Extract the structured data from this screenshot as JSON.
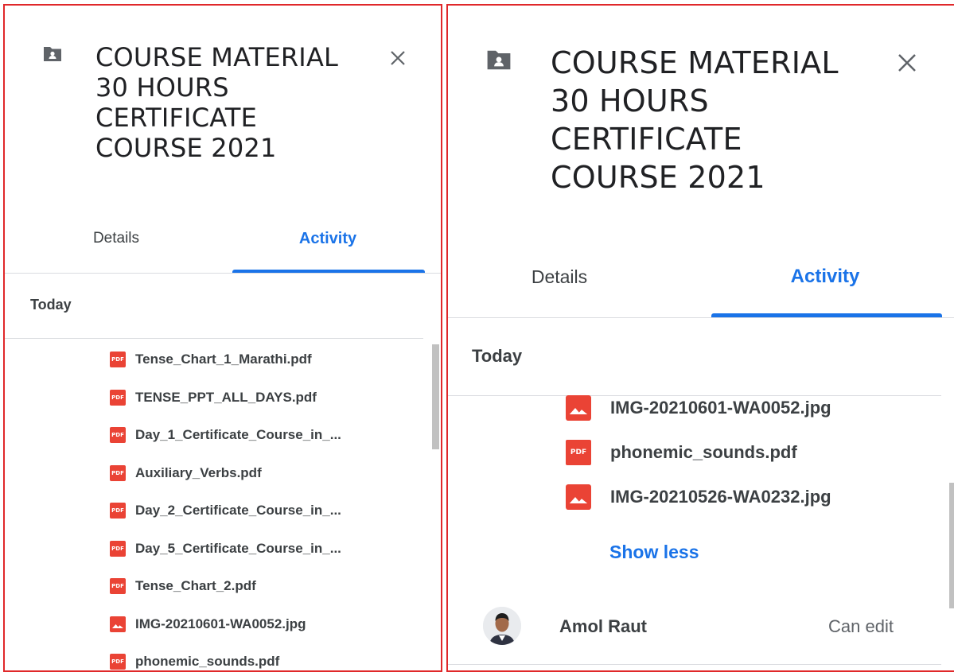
{
  "left_panel": {
    "folder_icon": "shared-folder-icon",
    "close_icon": "close-icon",
    "title_lines": [
      "COURSE MATERIAL",
      "30 HOURS",
      "CERTIFICATE",
      "COURSE 2021"
    ],
    "tabs": [
      {
        "label": "Details",
        "active": false
      },
      {
        "label": "Activity",
        "active": true
      }
    ],
    "section_label": "Today",
    "files": [
      {
        "type": "pdf",
        "icon_text": "PDF",
        "name": "Tense_Chart_1_Marathi.pdf"
      },
      {
        "type": "pdf",
        "icon_text": "PDF",
        "name": "TENSE_PPT_ALL_DAYS.pdf"
      },
      {
        "type": "pdf",
        "icon_text": "PDF",
        "name": "Day_1_Certificate_Course_in_..."
      },
      {
        "type": "pdf",
        "icon_text": "PDF",
        "name": "Auxiliary_Verbs.pdf"
      },
      {
        "type": "pdf",
        "icon_text": "PDF",
        "name": "Day_2_Certificate_Course_in_..."
      },
      {
        "type": "pdf",
        "icon_text": "PDF",
        "name": "Day_5_Certificate_Course_in_..."
      },
      {
        "type": "pdf",
        "icon_text": "PDF",
        "name": "Tense_Chart_2.pdf"
      },
      {
        "type": "image",
        "icon_text": "",
        "name": "IMG-20210601-WA0052.jpg"
      },
      {
        "type": "pdf",
        "icon_text": "PDF",
        "name": "phonemic_sounds.pdf"
      }
    ]
  },
  "right_panel": {
    "folder_icon": "shared-folder-icon",
    "close_icon": "close-icon",
    "title_lines": [
      "COURSE MATERIAL",
      "30 HOURS",
      "CERTIFICATE",
      "COURSE 2021"
    ],
    "tabs": [
      {
        "label": "Details",
        "active": false
      },
      {
        "label": "Activity",
        "active": true
      }
    ],
    "section_label": "Today",
    "files": [
      {
        "type": "image",
        "icon_text": "",
        "name": "IMG-20210601-WA0052.jpg"
      },
      {
        "type": "pdf",
        "icon_text": "PDF",
        "name": "phonemic_sounds.pdf"
      },
      {
        "type": "image",
        "icon_text": "",
        "name": "IMG-20210526-WA0232.jpg"
      }
    ],
    "show_less_label": "Show less",
    "person": {
      "name": "Amol Raut",
      "permission": "Can edit",
      "avatar_icon": "user-avatar"
    }
  },
  "colors": {
    "accent": "#1a73e8",
    "pdf_red": "#ea4335",
    "border_red": "#e0282a"
  }
}
